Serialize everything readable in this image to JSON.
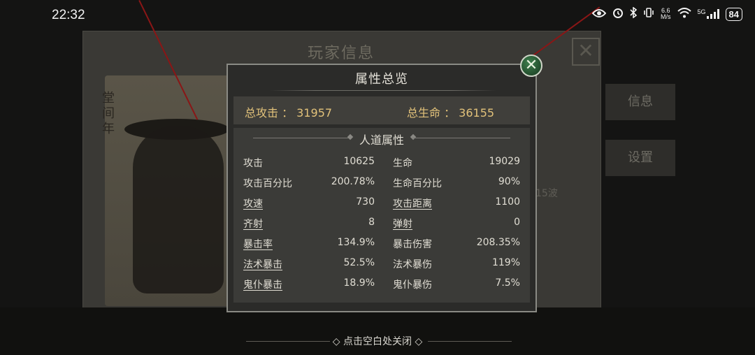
{
  "status_bar": {
    "time": "22:32",
    "net_speed_top": "6.6",
    "net_speed_unit": "M/s",
    "signal_label": "5G",
    "battery": "84",
    "icons": [
      "eye-icon",
      "alarm-icon",
      "bluetooth-icon",
      "vibrate-icon",
      "wifi-icon",
      "cellular-icon",
      "battery-icon"
    ]
  },
  "background": {
    "panel_title": "玩家信息",
    "side_buttons": [
      "信息",
      "设置"
    ],
    "portrait_text": "堂间年",
    "wave_text": "15波"
  },
  "modal": {
    "title": "属性总览",
    "summary": {
      "attack_label": "总攻击 ： 31957",
      "hp_label": "总生命 ： 36155"
    },
    "section_title": "人道属性",
    "rows": [
      {
        "l_label": "攻击",
        "l_value": "10625",
        "r_label": "生命",
        "r_value": "19029",
        "l_link": false,
        "r_link": false
      },
      {
        "l_label": "攻击百分比",
        "l_value": "200.78%",
        "r_label": "生命百分比",
        "r_value": "90%",
        "l_link": false,
        "r_link": false
      },
      {
        "l_label": "攻速",
        "l_value": "730",
        "r_label": "攻击距离",
        "r_value": "1100",
        "l_link": true,
        "r_link": true
      },
      {
        "l_label": "齐射",
        "l_value": "8",
        "r_label": "弹射",
        "r_value": "0",
        "l_link": true,
        "r_link": true
      },
      {
        "l_label": "暴击率",
        "l_value": "134.9%",
        "r_label": "暴击伤害",
        "r_value": "208.35%",
        "l_link": true,
        "r_link": false
      },
      {
        "l_label": "法术暴击",
        "l_value": "52.5%",
        "r_label": "法术暴伤",
        "r_value": "119%",
        "l_link": true,
        "r_link": false
      },
      {
        "l_label": "鬼仆暴击",
        "l_value": "18.9%",
        "r_label": "鬼仆暴伤",
        "r_value": "7.5%",
        "l_link": true,
        "r_link": false
      }
    ],
    "close_hint": "点击空白处关闭"
  },
  "colors": {
    "accent_gold": "#e2c27a",
    "close_green": "#2f6b3d"
  }
}
